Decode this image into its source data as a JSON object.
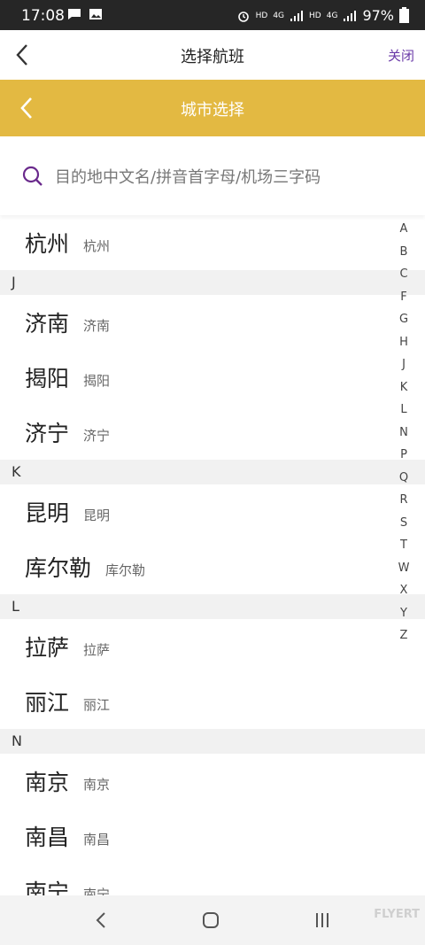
{
  "status": {
    "time": "17:08",
    "hd1": "HD",
    "lte1": "4G",
    "hd2": "HD",
    "lte2": "4G",
    "battery": "97%"
  },
  "appbar": {
    "title": "选择航班",
    "close": "关闭"
  },
  "header": {
    "title": "城市选择"
  },
  "search": {
    "placeholder": "目的地中文名/拼音首字母/机场三字码",
    "value": ""
  },
  "list": [
    {
      "type": "city",
      "name": "杭州",
      "sub": "杭州"
    },
    {
      "type": "section",
      "label": "J"
    },
    {
      "type": "city",
      "name": "济南",
      "sub": "济南"
    },
    {
      "type": "city",
      "name": "揭阳",
      "sub": "揭阳"
    },
    {
      "type": "city",
      "name": "济宁",
      "sub": "济宁"
    },
    {
      "type": "section",
      "label": "K"
    },
    {
      "type": "city",
      "name": "昆明",
      "sub": "昆明"
    },
    {
      "type": "city",
      "name": "库尔勒",
      "sub": "库尔勒"
    },
    {
      "type": "section",
      "label": "L"
    },
    {
      "type": "city",
      "name": "拉萨",
      "sub": "拉萨"
    },
    {
      "type": "city",
      "name": "丽江",
      "sub": "丽江"
    },
    {
      "type": "section",
      "label": "N"
    },
    {
      "type": "city",
      "name": "南京",
      "sub": "南京"
    },
    {
      "type": "city",
      "name": "南昌",
      "sub": "南昌"
    },
    {
      "type": "city",
      "name": "南宁",
      "sub": "南宁"
    }
  ],
  "index": [
    "A",
    "B",
    "C",
    "F",
    "G",
    "H",
    "J",
    "K",
    "L",
    "N",
    "P",
    "Q",
    "R",
    "S",
    "T",
    "W",
    "X",
    "Y",
    "Z"
  ],
  "watermark": "FLYERT"
}
